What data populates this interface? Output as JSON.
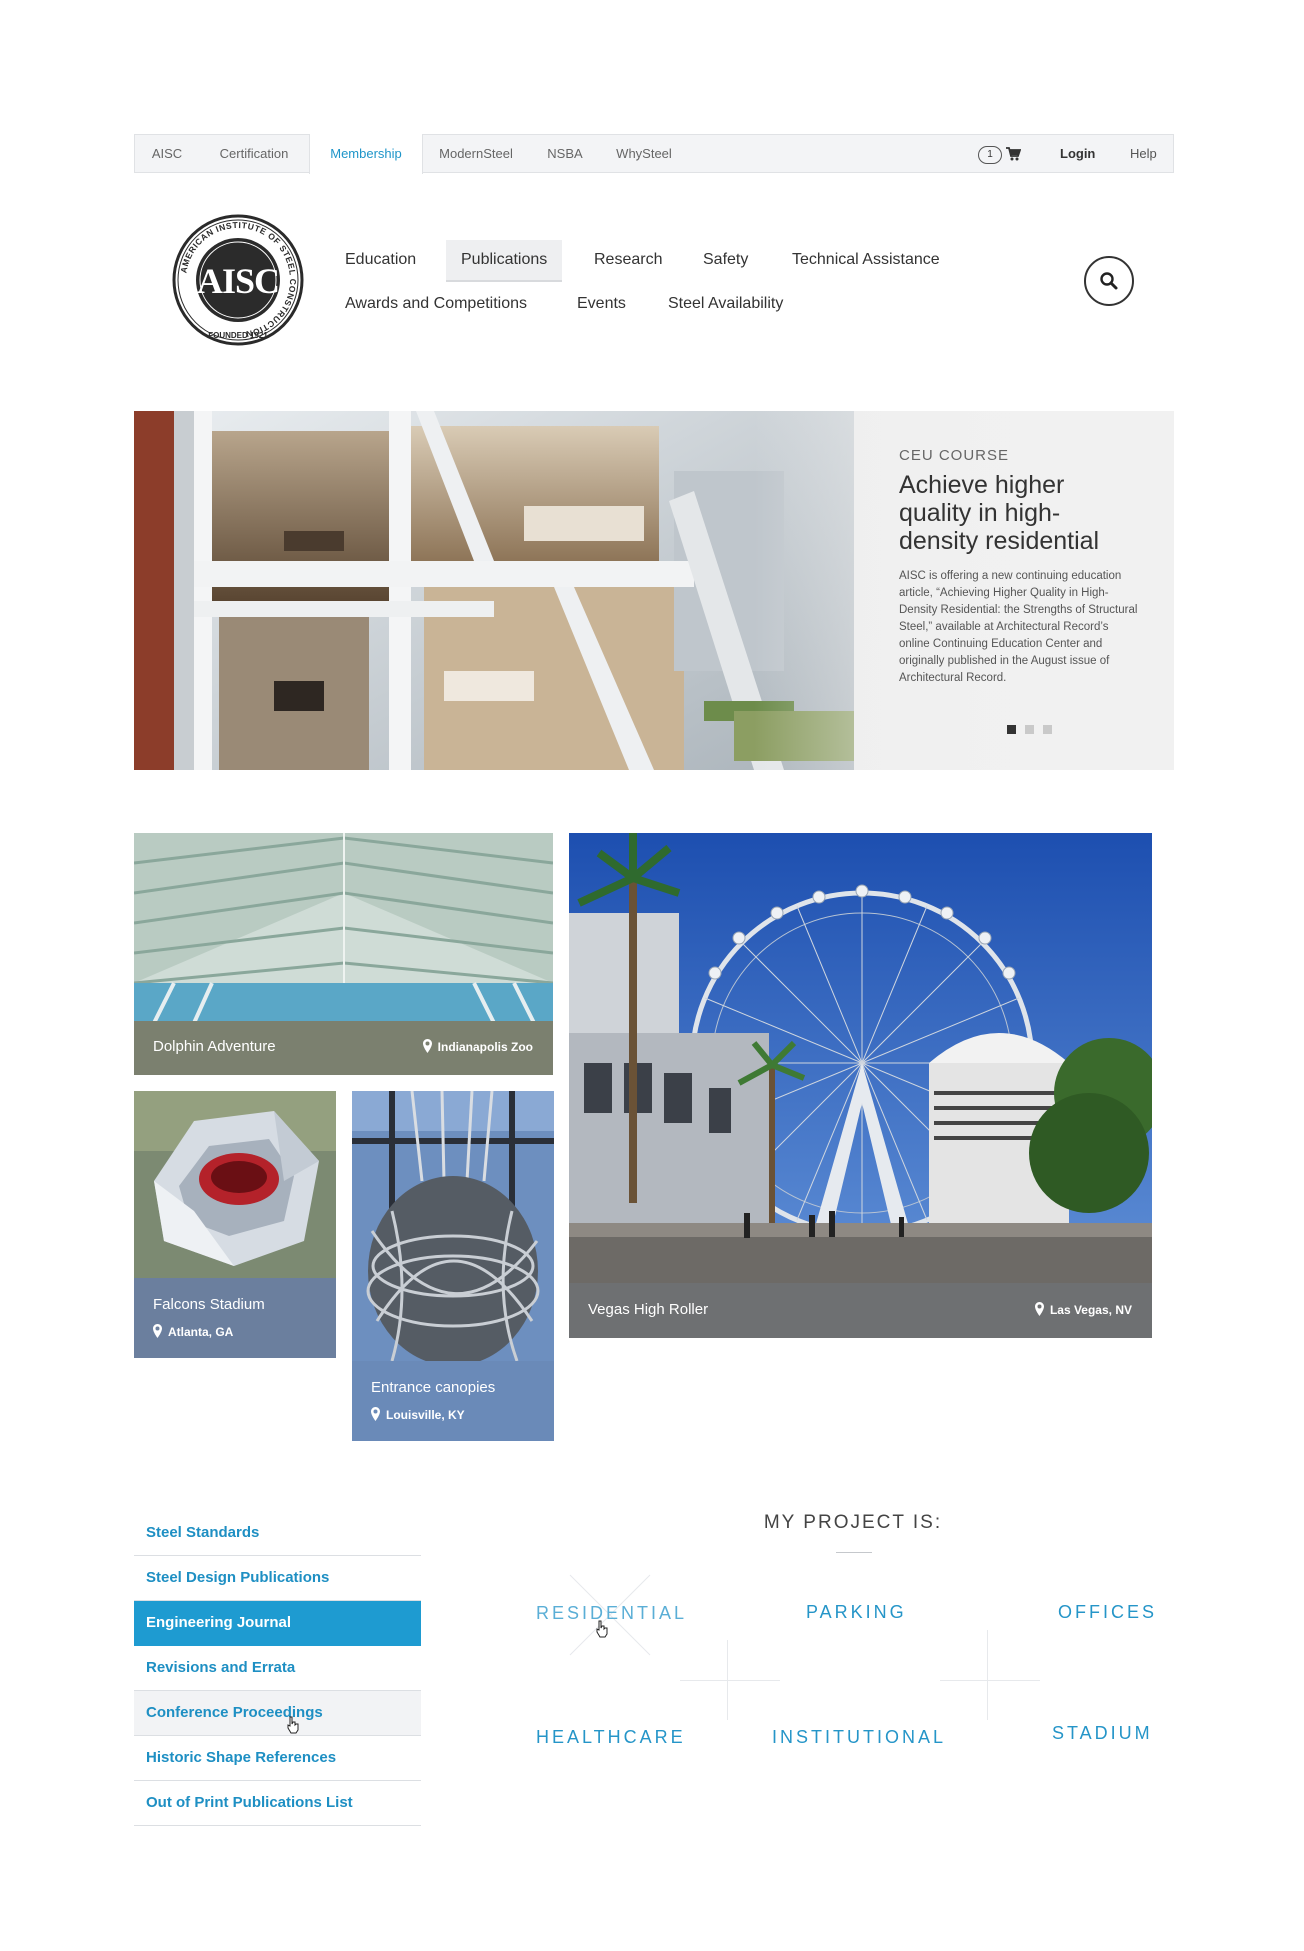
{
  "topbar": {
    "sites": [
      "AISC",
      "Certification",
      "Membership",
      "ModernSteel",
      "NSBA",
      "WhySteel"
    ],
    "active_site": "Membership",
    "cart_count": "1",
    "login_label": "Login",
    "help_label": "Help"
  },
  "logo": {
    "monogram": "AISC",
    "ring_text": "AMERICAN INSTITUTE OF STEEL CONSTRUCTION",
    "founded": "FOUNDED 1921"
  },
  "mainnav": {
    "row1": [
      "Education",
      "Publications",
      "Research",
      "Safety",
      "Technical Assistance"
    ],
    "row2": [
      "Awards and Competitions",
      "Events",
      "Steel Availability"
    ],
    "active": "Publications"
  },
  "hero": {
    "kicker": "CEU COURSE",
    "title": "Achieve higher quality in high-density residential",
    "body": "AISC is offering a new continuing education article, “Achieving Higher Quality in High-Density Residential: the Strengths of Structural Steel,” available at Architectural Record’s online Continuing Education Center and originally published in the August issue of Architectural Record.",
    "slides": 3,
    "active_slide": 1
  },
  "tiles": [
    {
      "name": "Dolphin Adventure",
      "location": "Indianapolis Zoo"
    },
    {
      "name": "Falcons Stadium",
      "location": "Atlanta, GA"
    },
    {
      "name": "Entrance canopies",
      "location": "Louisville, KY"
    },
    {
      "name": "Vegas High Roller",
      "location": "Las Vegas, NV"
    }
  ],
  "sidebar": {
    "items": [
      {
        "label": "Steel Standards"
      },
      {
        "label": "Steel Design Publications"
      },
      {
        "label": "Engineering Journal"
      },
      {
        "label": "Revisions and Errata"
      },
      {
        "label": "Conference Proceedings"
      },
      {
        "label": "Historic Shape References"
      },
      {
        "label": "Out of Print Publications List"
      }
    ],
    "active": "Engineering Journal",
    "hovered": "Conference Proceedings"
  },
  "project": {
    "heading": "MY PROJECT IS:",
    "options": [
      "RESIDENTIAL",
      "PARKING",
      "OFFICES",
      "HEALTHCARE",
      "INSTITUTIONAL",
      "STADIUM"
    ]
  },
  "colors": {
    "accent": "#1e9bd1",
    "link": "#1e8fc3",
    "tile_gray": "#6e7072",
    "tile_slate": "#6b7f9e",
    "tile_blue": "#6a8ab8",
    "tile_olive": "#7b806f"
  },
  "icons": {
    "cart": "cart-icon",
    "search": "search-icon",
    "location": "location-pin-icon"
  }
}
